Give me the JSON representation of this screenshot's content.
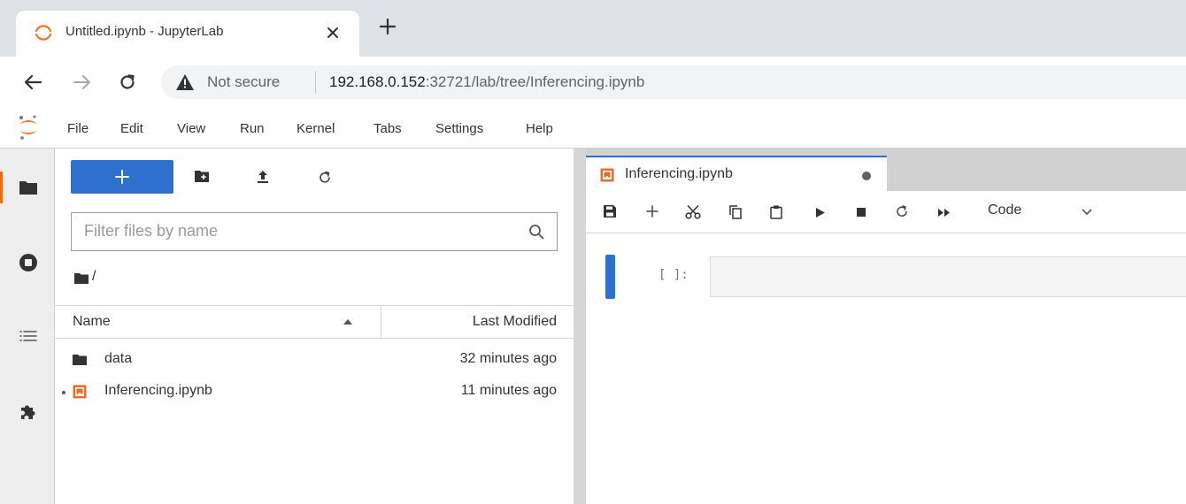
{
  "browser": {
    "tab_title": "Untitled.ipynb - JupyterLab",
    "security_label": "Not secure",
    "url_host": "192.168.0.152",
    "url_rest": ":32721/lab/tree/Inferencing.ipynb"
  },
  "menu": {
    "items": [
      "File",
      "Edit",
      "View",
      "Run",
      "Kernel",
      "Tabs",
      "Settings",
      "Help"
    ]
  },
  "file_browser": {
    "filter_placeholder": "Filter files by name",
    "breadcrumb": "/",
    "columns": {
      "name": "Name",
      "modified": "Last Modified"
    },
    "sort_direction": "ascending",
    "files": [
      {
        "name": "data",
        "modified": "32 minutes ago",
        "type": "folder",
        "running": false
      },
      {
        "name": "Inferencing.ipynb",
        "modified": "11 minutes ago",
        "type": "notebook",
        "running": true
      }
    ]
  },
  "notebook": {
    "tab_title": "Inferencing.ipynb",
    "unsaved": true,
    "cell_type": "Code",
    "cell_prompt": "[ ]:",
    "cell_source": ""
  },
  "colors": {
    "accent_blue": "#2f6fce",
    "jupyter_orange": "#f37726",
    "notebook_icon": "#e46e2e"
  }
}
